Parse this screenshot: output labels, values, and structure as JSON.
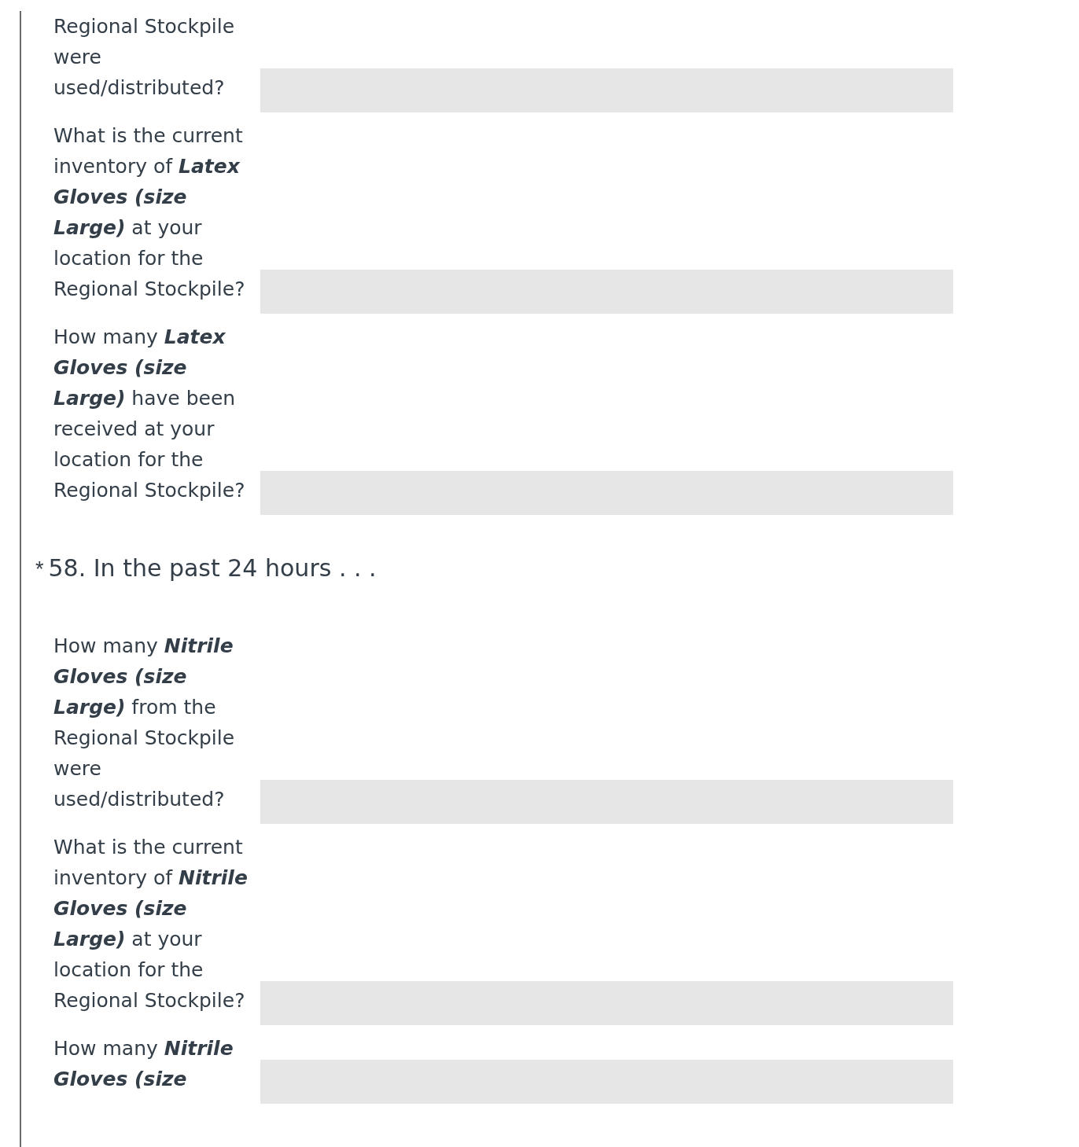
{
  "blocks": [
    {
      "kind": "question",
      "label": "Regional Stockpile were used/distributed?"
    },
    {
      "kind": "question",
      "label": "What is the current inventory of **Latex Gloves (size Large)** at your location for the Regional Stockpile?"
    },
    {
      "kind": "question",
      "label": "How many **Latex Gloves (size Large)** have been received at your location for the Regional Stockpile?"
    },
    {
      "kind": "heading",
      "marker": "*",
      "text": "58. In the past 24 hours . . ."
    },
    {
      "kind": "question",
      "label": "How many **Nitrile Gloves (size Large)** from the Regional Stockpile were used/distributed?"
    },
    {
      "kind": "question",
      "label": "What is the current inventory of **Nitrile Gloves (size Large)** at your location for the Regional Stockpile?"
    },
    {
      "kind": "question",
      "label": "How many **Nitrile Gloves (size**"
    }
  ]
}
